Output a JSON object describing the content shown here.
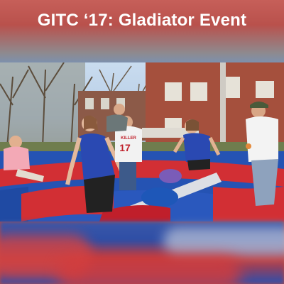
{
  "header": {
    "title": "GITC ‘17: Gladiator Event"
  },
  "photo": {
    "jersey_number": "17",
    "jersey_name": "KILLER"
  },
  "colors": {
    "inflatable_blue": "#2553b3",
    "inflatable_red": "#d22f34",
    "shirt_blue": "#2a49b2"
  }
}
